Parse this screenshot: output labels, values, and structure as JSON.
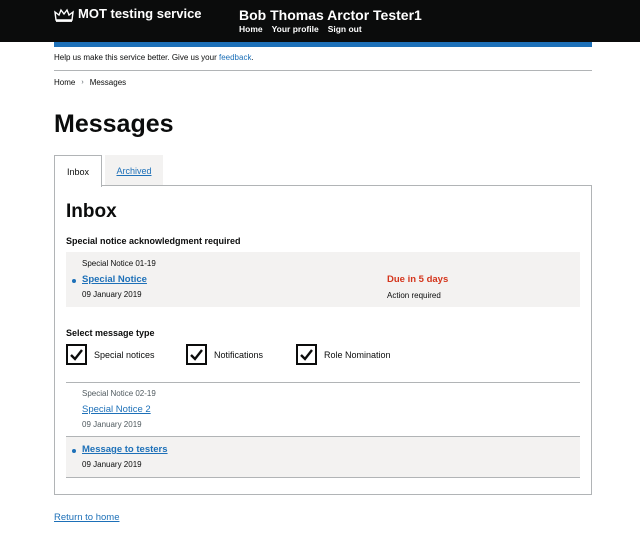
{
  "header": {
    "service_name": "MOT testing service",
    "user_name": "Bob Thomas Arctor Tester1",
    "nav": [
      "Home",
      "Your profile",
      "Sign out"
    ]
  },
  "feedback": {
    "text": "Help us make this service better. Give us your",
    "link": "feedback",
    "suffix": "."
  },
  "breadcrumb": {
    "home": "Home",
    "current": "Messages"
  },
  "page_title": "Messages",
  "tabs": {
    "inbox": "Inbox",
    "archived": "Archived"
  },
  "inbox": {
    "heading": "Inbox",
    "ack_label": "Special notice acknowledgment required",
    "ack_notice": {
      "reference": "Special Notice 01-19",
      "title": "Special Notice",
      "date": "09 January 2019",
      "status": "Due in 5 days",
      "status_sub": "Action required"
    },
    "select_label": "Select message type",
    "filters": [
      "Special notices",
      "Notifications",
      "Role Nomination"
    ],
    "messages": [
      {
        "reference": "Special Notice 02-19",
        "title": "Special Notice  2",
        "date": "09 January 2019"
      },
      {
        "title": "Message to testers",
        "date": "09 January 2019"
      }
    ]
  },
  "return_link": "Return to home",
  "colors": {
    "header_bg": "#0b0c0c",
    "link_blue": "#1d70b8",
    "due_red": "#d4351c",
    "panel_grey": "#f3f2f1"
  }
}
